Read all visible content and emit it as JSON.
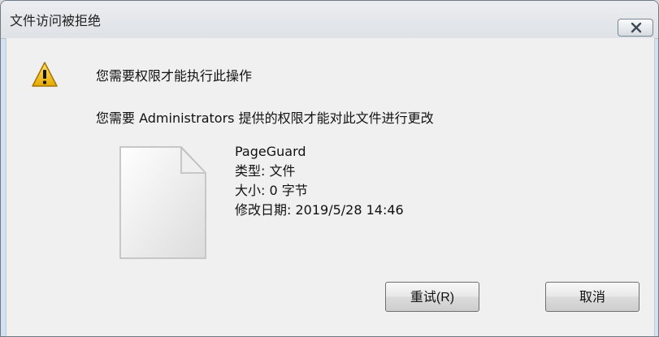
{
  "window": {
    "title": "文件访问被拒绝"
  },
  "dialog": {
    "main_instruction": "您需要权限才能执行此操作",
    "sub_instruction": "您需要 Administrators 提供的权限才能对此文件进行更改",
    "file": {
      "name": "PageGuard",
      "type": "类型: 文件",
      "size": "大小: 0 字节",
      "modified": "修改日期: 2019/5/28 14:46"
    }
  },
  "buttons": {
    "retry": "重试(R)",
    "cancel": "取消"
  },
  "icons": {
    "close": "close-icon",
    "warning": "warning-icon",
    "file": "file-icon"
  },
  "colors": {
    "title_bar": "#e5e8eb",
    "dialog_body": "#f0f0f0",
    "warning_yellow": "#f3c324"
  }
}
